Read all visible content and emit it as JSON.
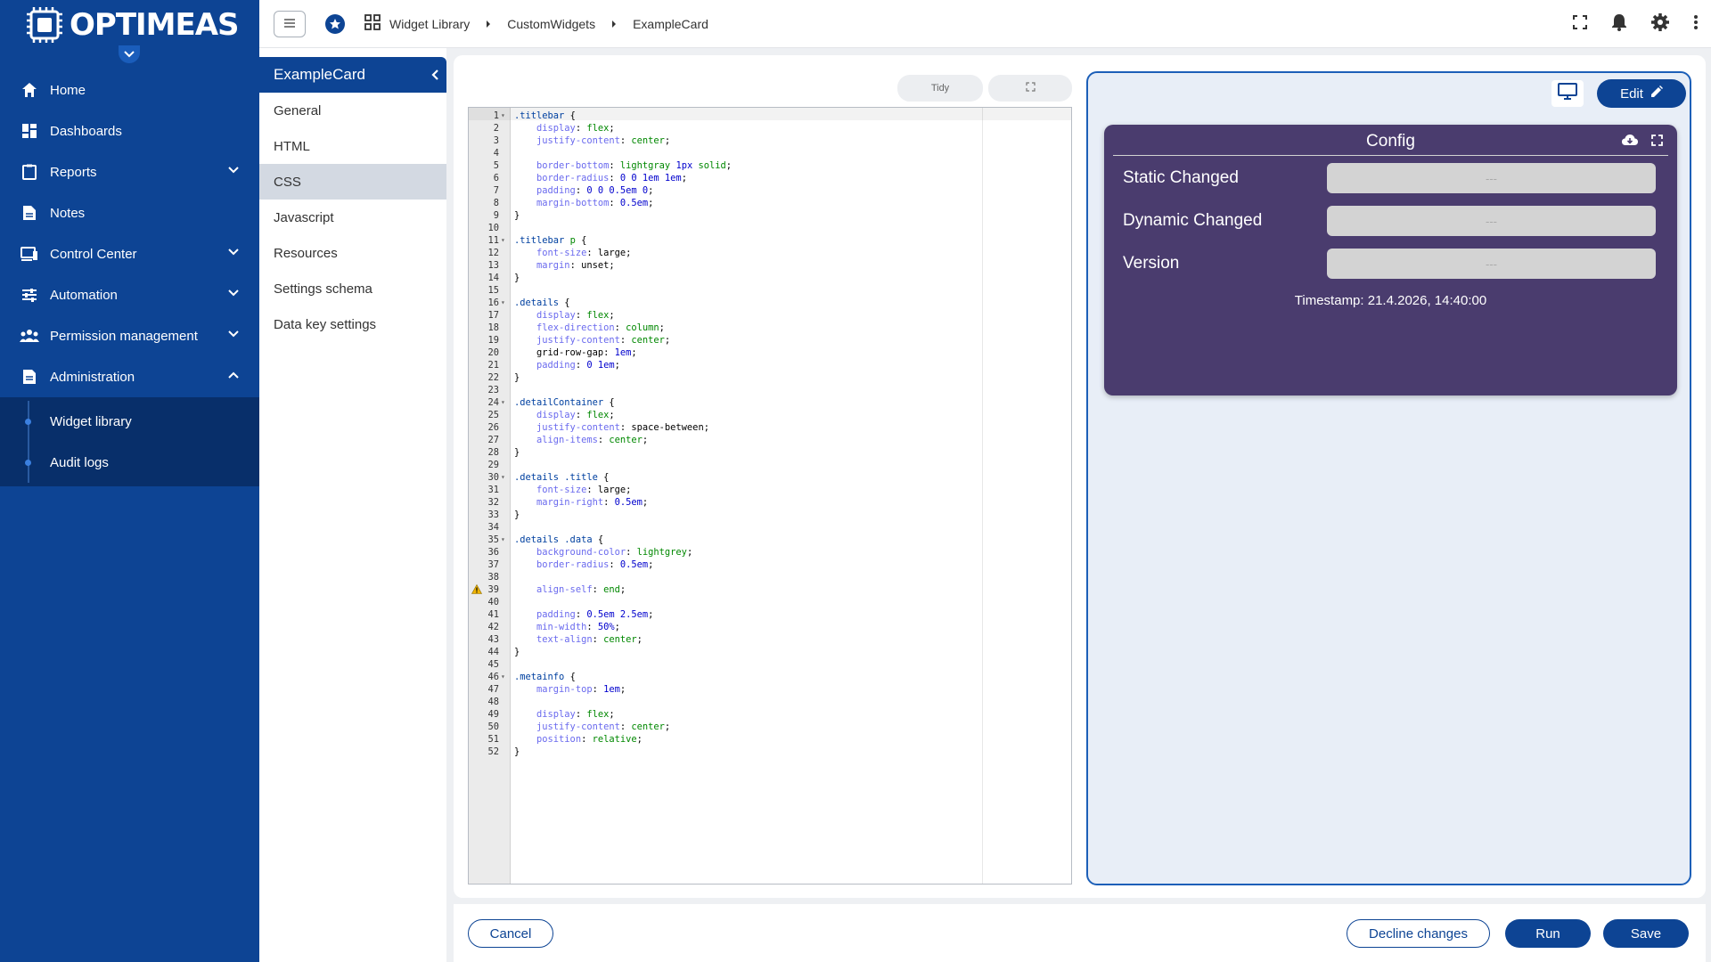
{
  "app": {
    "logo_text": "OPTIMEAS"
  },
  "sidebar": {
    "items": [
      {
        "label": "Home",
        "icon": "home-icon",
        "expandable": false
      },
      {
        "label": "Dashboards",
        "icon": "dashboard-icon",
        "expandable": false
      },
      {
        "label": "Reports",
        "icon": "reports-icon",
        "expandable": true
      },
      {
        "label": "Notes",
        "icon": "notes-icon",
        "expandable": false
      },
      {
        "label": "Control Center",
        "icon": "control-center-icon",
        "expandable": true
      },
      {
        "label": "Automation",
        "icon": "automation-icon",
        "expandable": true
      },
      {
        "label": "Permission management",
        "icon": "people-icon",
        "expandable": true
      },
      {
        "label": "Administration",
        "icon": "administration-icon",
        "expandable": true,
        "expanded": true
      }
    ],
    "sub_items": [
      {
        "label": "Widget library",
        "active": true
      },
      {
        "label": "Audit logs",
        "active": false
      }
    ]
  },
  "breadcrumb": [
    "Widget Library",
    "CustomWidgets",
    "ExampleCard"
  ],
  "settings": {
    "title": "ExampleCard",
    "items": [
      "General",
      "HTML",
      "CSS",
      "Javascript",
      "Resources",
      "Settings schema",
      "Data key settings"
    ],
    "active": "CSS"
  },
  "editor": {
    "tidy_label": "Tidy",
    "lines": [
      [
        [
          ".titlebar",
          "sel"
        ],
        [
          " {",
          "un"
        ]
      ],
      [
        [
          "    display",
          "prop"
        ],
        [
          ": ",
          "un"
        ],
        [
          "flex",
          "kw"
        ],
        [
          ";",
          "un"
        ]
      ],
      [
        [
          "    justify-content",
          "prop"
        ],
        [
          ": ",
          "un"
        ],
        [
          "center",
          "kw"
        ],
        [
          ";",
          "un"
        ]
      ],
      [],
      [
        [
          "    border-bottom",
          "prop"
        ],
        [
          ": ",
          "un"
        ],
        [
          "lightgray",
          "kw"
        ],
        [
          " ",
          "un"
        ],
        [
          "1px",
          "num"
        ],
        [
          " ",
          "un"
        ],
        [
          "solid",
          "kw"
        ],
        [
          ";",
          "un"
        ]
      ],
      [
        [
          "    border-radius",
          "prop"
        ],
        [
          ": ",
          "un"
        ],
        [
          "0 0 1em 1em",
          "num"
        ],
        [
          ";",
          "un"
        ]
      ],
      [
        [
          "    padding",
          "prop"
        ],
        [
          ": ",
          "un"
        ],
        [
          "0 0 0.5em 0",
          "num"
        ],
        [
          ";",
          "un"
        ]
      ],
      [
        [
          "    margin-bottom",
          "prop"
        ],
        [
          ": ",
          "un"
        ],
        [
          "0.5em",
          "num"
        ],
        [
          ";",
          "un"
        ]
      ],
      [
        [
          "}",
          "un"
        ]
      ],
      [],
      [
        [
          ".titlebar",
          "sel"
        ],
        [
          " ",
          "un"
        ],
        [
          "p",
          "kw"
        ],
        [
          " {",
          "un"
        ]
      ],
      [
        [
          "    font-size",
          "prop"
        ],
        [
          ": large;",
          "un"
        ]
      ],
      [
        [
          "    margin",
          "prop"
        ],
        [
          ": unset;",
          "un"
        ]
      ],
      [
        [
          "}",
          "un"
        ]
      ],
      [],
      [
        [
          ".details",
          "sel"
        ],
        [
          " {",
          "un"
        ]
      ],
      [
        [
          "    display",
          "prop"
        ],
        [
          ": ",
          "un"
        ],
        [
          "flex",
          "kw"
        ],
        [
          ";",
          "un"
        ]
      ],
      [
        [
          "    flex-direction",
          "prop"
        ],
        [
          ": ",
          "un"
        ],
        [
          "column",
          "kw"
        ],
        [
          ";",
          "un"
        ]
      ],
      [
        [
          "    justify-content",
          "prop"
        ],
        [
          ": ",
          "un"
        ],
        [
          "center",
          "kw"
        ],
        [
          ";",
          "un"
        ]
      ],
      [
        [
          "    grid-row-gap",
          "un"
        ],
        [
          ": ",
          "un"
        ],
        [
          "1em",
          "num"
        ],
        [
          ";",
          "un"
        ]
      ],
      [
        [
          "    padding",
          "prop"
        ],
        [
          ": ",
          "un"
        ],
        [
          "0 1em",
          "num"
        ],
        [
          ";",
          "un"
        ]
      ],
      [
        [
          "}",
          "un"
        ]
      ],
      [],
      [
        [
          ".detailContainer",
          "sel"
        ],
        [
          " {",
          "un"
        ]
      ],
      [
        [
          "    display",
          "prop"
        ],
        [
          ": ",
          "un"
        ],
        [
          "flex",
          "kw"
        ],
        [
          ";",
          "un"
        ]
      ],
      [
        [
          "    justify-content",
          "prop"
        ],
        [
          ": space-between;",
          "un"
        ]
      ],
      [
        [
          "    align-items",
          "prop"
        ],
        [
          ": ",
          "un"
        ],
        [
          "center",
          "kw"
        ],
        [
          ";",
          "un"
        ]
      ],
      [
        [
          "}",
          "un"
        ]
      ],
      [],
      [
        [
          ".details .title",
          "sel"
        ],
        [
          " {",
          "un"
        ]
      ],
      [
        [
          "    font-size",
          "prop"
        ],
        [
          ": large;",
          "un"
        ]
      ],
      [
        [
          "    margin-right",
          "prop"
        ],
        [
          ": ",
          "un"
        ],
        [
          "0.5em",
          "num"
        ],
        [
          ";",
          "un"
        ]
      ],
      [
        [
          "}",
          "un"
        ]
      ],
      [],
      [
        [
          ".details .data",
          "sel"
        ],
        [
          " {",
          "un"
        ]
      ],
      [
        [
          "    background-color",
          "prop"
        ],
        [
          ": ",
          "un"
        ],
        [
          "lightgrey",
          "kw"
        ],
        [
          ";",
          "un"
        ]
      ],
      [
        [
          "    border-radius",
          "prop"
        ],
        [
          ": ",
          "un"
        ],
        [
          "0.5em",
          "num"
        ],
        [
          ";",
          "un"
        ]
      ],
      [],
      [
        [
          "    align-self",
          "prop"
        ],
        [
          ": ",
          "un"
        ],
        [
          "end",
          "kw"
        ],
        [
          ";",
          "un"
        ]
      ],
      [],
      [
        [
          "    padding",
          "prop"
        ],
        [
          ": ",
          "un"
        ],
        [
          "0.5em 2.5em",
          "num"
        ],
        [
          ";",
          "un"
        ]
      ],
      [
        [
          "    min-width",
          "prop"
        ],
        [
          ": ",
          "un"
        ],
        [
          "50%",
          "num"
        ],
        [
          ";",
          "un"
        ]
      ],
      [
        [
          "    text-align",
          "prop"
        ],
        [
          ": ",
          "un"
        ],
        [
          "center",
          "kw"
        ],
        [
          ";",
          "un"
        ]
      ],
      [
        [
          "}",
          "un"
        ]
      ],
      [],
      [
        [
          ".metainfo",
          "sel"
        ],
        [
          " {",
          "un"
        ]
      ],
      [
        [
          "    margin-top",
          "prop"
        ],
        [
          ": ",
          "un"
        ],
        [
          "1em",
          "num"
        ],
        [
          ";",
          "un"
        ]
      ],
      [],
      [
        [
          "    display",
          "prop"
        ],
        [
          ": ",
          "un"
        ],
        [
          "flex",
          "kw"
        ],
        [
          ";",
          "un"
        ]
      ],
      [
        [
          "    justify-content",
          "prop"
        ],
        [
          ": ",
          "un"
        ],
        [
          "center",
          "kw"
        ],
        [
          ";",
          "un"
        ]
      ],
      [
        [
          "    position",
          "prop"
        ],
        [
          ": ",
          "un"
        ],
        [
          "relative",
          "kw"
        ],
        [
          ";",
          "un"
        ]
      ],
      [
        [
          "}",
          "un"
        ]
      ]
    ],
    "fold_lines": [
      1,
      11,
      16,
      24,
      30,
      35,
      46
    ],
    "warning_lines": [
      39
    ]
  },
  "preview": {
    "edit_label": "Edit",
    "widget": {
      "title": "Config",
      "rows": [
        {
          "label": "Static Changed",
          "value": "---"
        },
        {
          "label": "Dynamic Changed",
          "value": "---"
        },
        {
          "label": "Version",
          "value": "---"
        }
      ],
      "timestamp": "Timestamp: 21.4.2026, 14:40:00",
      "bg_color": "#4a3c6e"
    }
  },
  "footer": {
    "cancel_label": "Cancel",
    "decline_label": "Decline changes",
    "run_label": "Run",
    "save_label": "Save"
  },
  "colors": {
    "brand": "#0d4494",
    "sidebar_sub_bg": "#082f6a",
    "preview_border": "#1c5fb8"
  }
}
